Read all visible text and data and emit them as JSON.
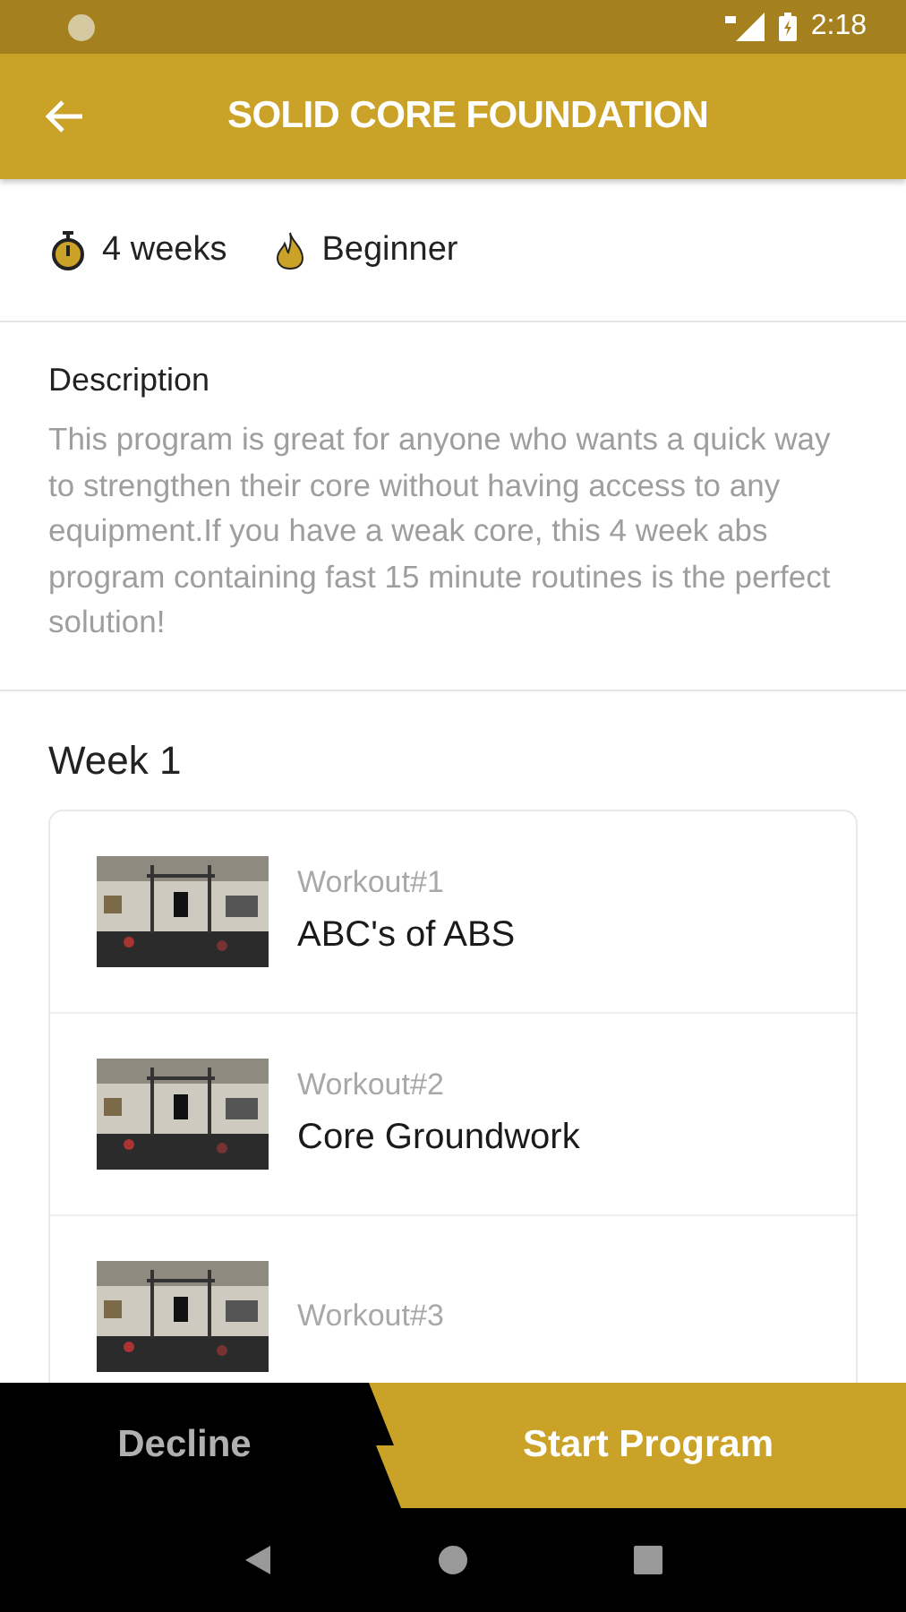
{
  "status_bar": {
    "time": "2:18"
  },
  "header": {
    "title": "SOLID CORE FOUNDATION"
  },
  "meta": {
    "duration": "4 weeks",
    "level": "Beginner"
  },
  "description": {
    "heading": "Description",
    "text": "This program is great for anyone who wants a quick way to strengthen their core without having access to any equipment.If you have a weak core, this 4 week abs program containing fast 15 minute routines is the perfect solution!"
  },
  "week": {
    "title": "Week 1",
    "workouts": [
      {
        "number": "Workout#1",
        "name": "ABC's of ABS"
      },
      {
        "number": "Workout#2",
        "name": "Core Groundwork"
      },
      {
        "number": "Workout#3"
      }
    ]
  },
  "actions": {
    "decline": "Decline",
    "start": "Start Program"
  }
}
